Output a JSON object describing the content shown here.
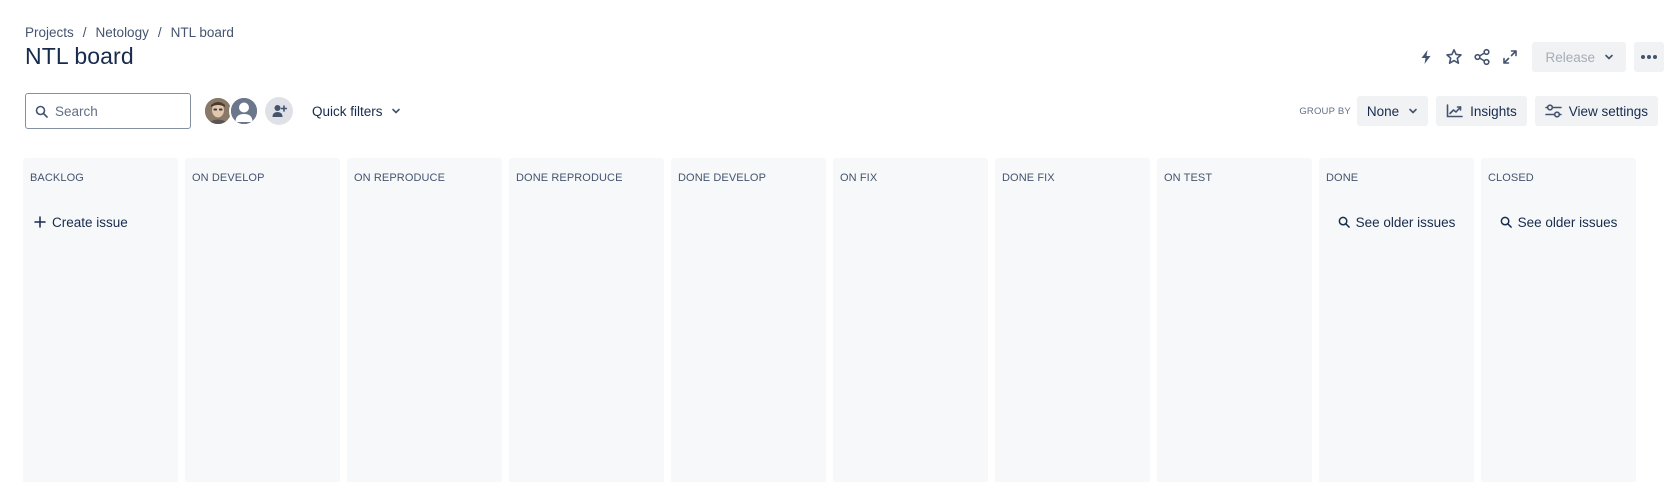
{
  "breadcrumb": [
    "Projects",
    "Netology",
    "NTL board"
  ],
  "breadcrumb_separator": "/",
  "page_title": "NTL board",
  "header_actions": {
    "icons": [
      "lightning-icon",
      "star-icon",
      "share-icon",
      "expand-icon"
    ],
    "release_label": "Release",
    "more_icon": "ellipsis-icon"
  },
  "search": {
    "placeholder": "Search",
    "value": ""
  },
  "quick_filters_label": "Quick filters",
  "group_by": {
    "label": "GROUP BY",
    "value": "None"
  },
  "insights_label": "Insights",
  "view_settings_label": "View settings",
  "columns": [
    {
      "title": "BACKLOG",
      "action": "Create issue"
    },
    {
      "title": "ON DEVELOP"
    },
    {
      "title": "ON REPRODUCE"
    },
    {
      "title": "DONE REPRODUCE"
    },
    {
      "title": "DONE DEVELOP"
    },
    {
      "title": "ON FIX"
    },
    {
      "title": "DONE FIX"
    },
    {
      "title": "ON TEST"
    },
    {
      "title": "DONE",
      "action": "See older issues"
    },
    {
      "title": "CLOSED",
      "action": "See older issues"
    }
  ],
  "colors": {
    "text": "#172b4d",
    "subtle_text": "#44546f",
    "column_bg": "#f7f8f9",
    "button_bg": "#f1f2f4"
  }
}
